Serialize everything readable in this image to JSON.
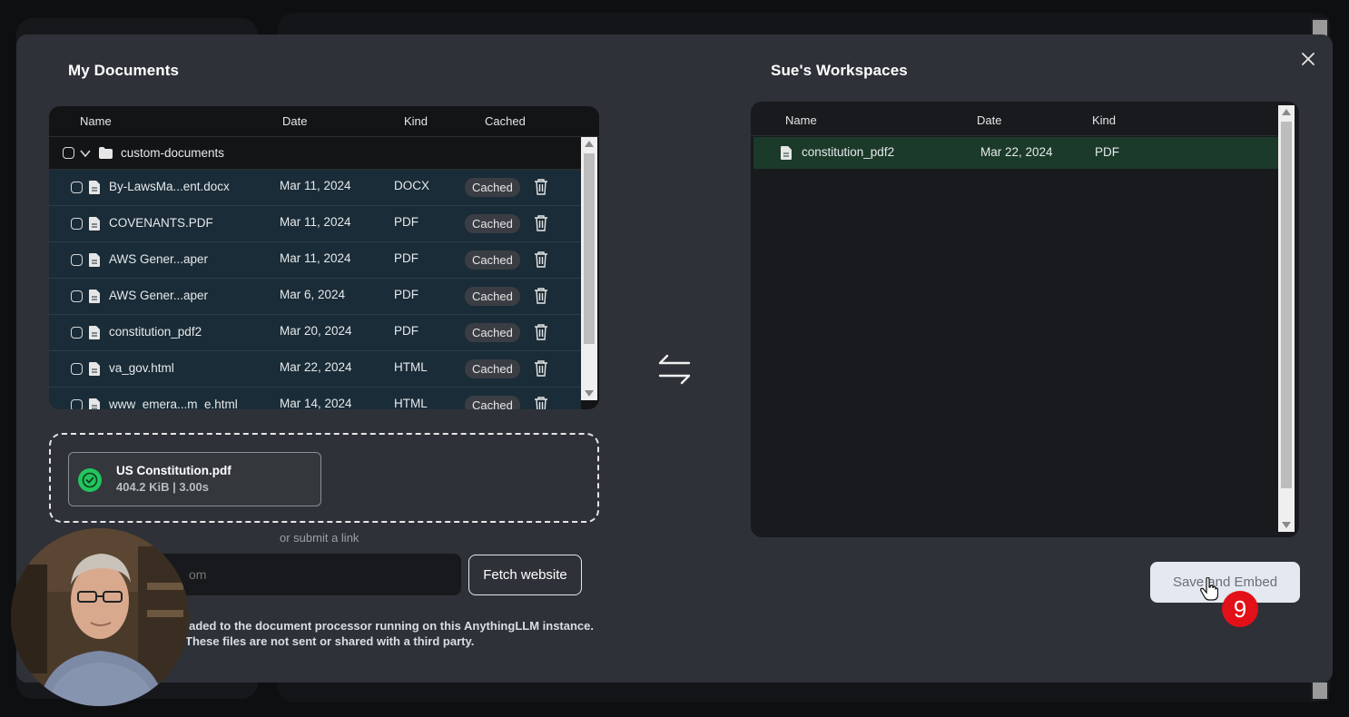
{
  "left_panel": {
    "title": "My Documents",
    "columns": [
      "Name",
      "Date",
      "Kind",
      "Cached"
    ],
    "folder": {
      "name": "custom-documents"
    },
    "files": [
      {
        "name": "By-LawsMa...ent.docx",
        "date": "Mar 11, 2024",
        "kind": "DOCX",
        "cached": "Cached"
      },
      {
        "name": "COVENANTS.PDF",
        "date": "Mar 11, 2024",
        "kind": "PDF",
        "cached": "Cached"
      },
      {
        "name": "AWS Gener...aper",
        "date": "Mar 11, 2024",
        "kind": "PDF",
        "cached": "Cached"
      },
      {
        "name": "AWS Gener...aper",
        "date": "Mar 6, 2024",
        "kind": "PDF",
        "cached": "Cached"
      },
      {
        "name": "constitution_pdf2",
        "date": "Mar 20, 2024",
        "kind": "PDF",
        "cached": "Cached"
      },
      {
        "name": "va_gov.html",
        "date": "Mar 22, 2024",
        "kind": "HTML",
        "cached": "Cached"
      },
      {
        "name": "www_emera...m_e.html",
        "date": "Mar 14, 2024",
        "kind": "HTML",
        "cached": "Cached"
      }
    ]
  },
  "upload": {
    "file_name": "US Constitution.pdf",
    "file_meta": "404.2 KiB | 3.00s",
    "or_text": "or submit a link",
    "url_placeholder": "om",
    "fetch_label": "Fetch website",
    "disclaimer_line1": "aded to the document processor running on this AnythingLLM instance.",
    "disclaimer_line2": "These files are not sent or shared with a third party."
  },
  "right_panel": {
    "title": "Sue's Workspaces",
    "columns": [
      "Name",
      "Date",
      "Kind"
    ],
    "files": [
      {
        "name": "constitution_pdf2",
        "date": "Mar 22, 2024",
        "kind": "PDF"
      }
    ]
  },
  "actions": {
    "save_label": "Save and Embed",
    "step_number": "9"
  },
  "colors": {
    "modal_bg": "#2e3238",
    "row_highlight_left": "#1a2c37",
    "row_highlight_right": "#1b3a2a",
    "success": "#22c55e",
    "step_badge": "#e21018"
  }
}
